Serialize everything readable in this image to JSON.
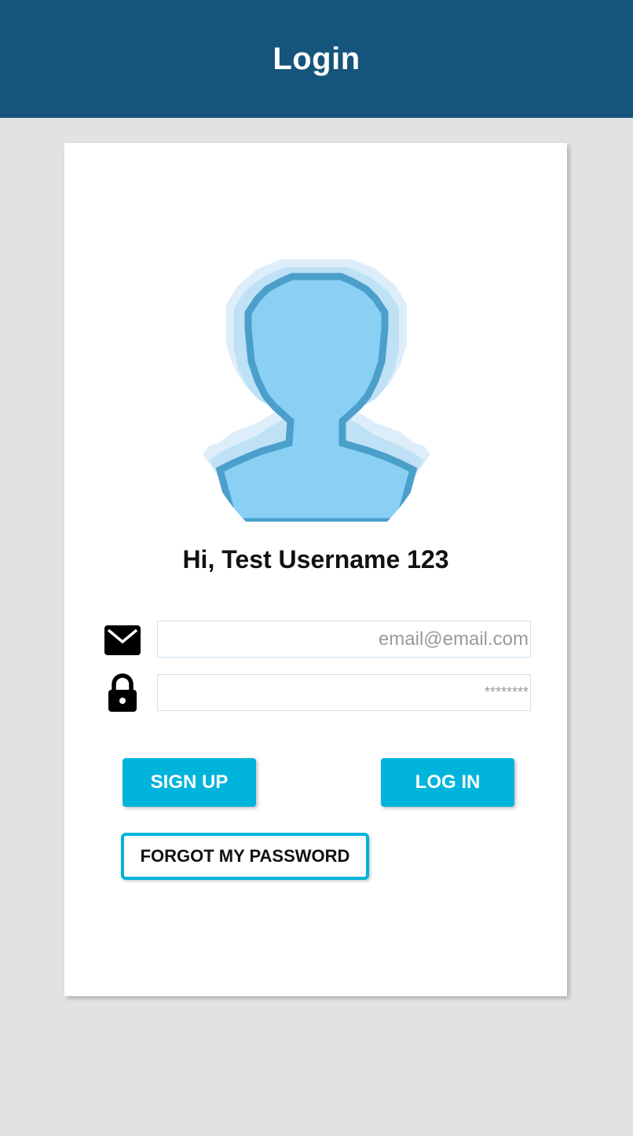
{
  "header": {
    "title": "Login"
  },
  "profile": {
    "greeting": "Hi, Test Username 123",
    "avatar_icon": "user-silhouette-icon"
  },
  "form": {
    "email": {
      "icon": "mail-icon",
      "placeholder": "email@email.com",
      "value": ""
    },
    "password": {
      "icon": "lock-icon",
      "placeholder": "********",
      "value": ""
    }
  },
  "actions": {
    "signup_label": "SIGN UP",
    "login_label": "LOG IN",
    "forgot_label": "FORGOT MY PASSWORD"
  },
  "colors": {
    "header_bg": "#15557b",
    "page_bg": "#e1e2e4",
    "accent": "#00b4db",
    "avatar_fill": "#8ad0f4",
    "avatar_outline": "#4b9fcb",
    "avatar_halo": "#cfe8f8"
  }
}
